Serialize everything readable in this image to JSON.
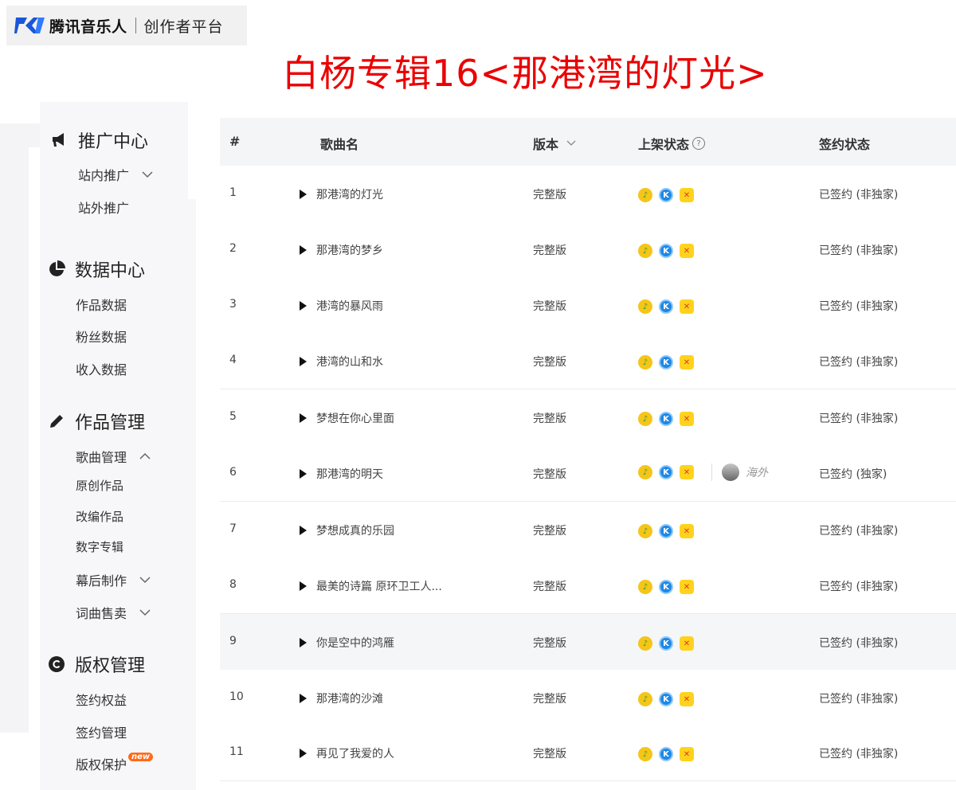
{
  "brand": {
    "name": "腾讯音乐人",
    "platform": "创作者平台"
  },
  "headline": "白杨专辑16<那港湾的灯光>",
  "sidebar": {
    "sections": [
      {
        "label": "推广中心",
        "icon": "megaphone-icon",
        "items": [
          {
            "label": "站内推广",
            "expand": "down"
          },
          {
            "label": "站外推广"
          }
        ]
      },
      {
        "label": "数据中心",
        "icon": "pie-chart-icon",
        "items": [
          {
            "label": "作品数据"
          },
          {
            "label": "粉丝数据"
          },
          {
            "label": "收入数据"
          }
        ]
      },
      {
        "label": "作品管理",
        "icon": "pencil-icon",
        "items": [
          {
            "label": "歌曲管理",
            "expand": "up"
          },
          {
            "label": "原创作品"
          },
          {
            "label": "改编作品"
          },
          {
            "label": "数字专辑"
          },
          {
            "label": "幕后制作",
            "expand": "down"
          },
          {
            "label": "词曲售卖",
            "expand": "down"
          }
        ]
      },
      {
        "label": "版权管理",
        "icon": "copyright-icon",
        "items": [
          {
            "label": "签约权益"
          },
          {
            "label": "签约管理"
          },
          {
            "label": "版权保护",
            "badge": "new"
          }
        ]
      }
    ]
  },
  "table": {
    "headers": {
      "index": "#",
      "song": "歌曲名",
      "version": "版本",
      "status": "上架状态",
      "sign": "签约状态"
    },
    "rows": [
      {
        "no": "1",
        "song": "那港湾的灯光",
        "version": "完整版",
        "sign": "已签约 (非独家)"
      },
      {
        "no": "2",
        "song": "那港湾的梦乡",
        "version": "完整版",
        "sign": "已签约 (非独家)"
      },
      {
        "no": "3",
        "song": "港湾的暴风雨",
        "version": "完整版",
        "sign": "已签约 (非独家)"
      },
      {
        "no": "4",
        "song": "港湾的山和水",
        "version": "完整版",
        "sign": "已签约 (非独家)"
      },
      {
        "no": "5",
        "song": "梦想在你心里面",
        "version": "完整版",
        "sign": "已签约 (非独家)"
      },
      {
        "no": "6",
        "song": "那港湾的明天",
        "version": "完整版",
        "sign": "已签约 (独家)",
        "overseas": "海外"
      },
      {
        "no": "7",
        "song": "梦想成真的乐园",
        "version": "完整版",
        "sign": "已签约 (非独家)"
      },
      {
        "no": "8",
        "song": "最美的诗篇 原环卫工人...",
        "version": "完整版",
        "sign": "已签约 (非独家)"
      },
      {
        "no": "9",
        "song": "你是空中的鸿雁",
        "version": "完整版",
        "sign": "已签约 (非独家)"
      },
      {
        "no": "10",
        "song": "那港湾的沙滩",
        "version": "完整版",
        "sign": "已签约 (非独家)"
      },
      {
        "no": "11",
        "song": "再见了我爱的人",
        "version": "完整版",
        "sign": "已签约 (非独家)"
      }
    ]
  },
  "colors": {
    "headline": "#ea0000",
    "new_badge": "#ff6b1a",
    "qq_music": "#f5c518",
    "kugou": "#1e88e5",
    "kuwo": "#ffd21c"
  }
}
